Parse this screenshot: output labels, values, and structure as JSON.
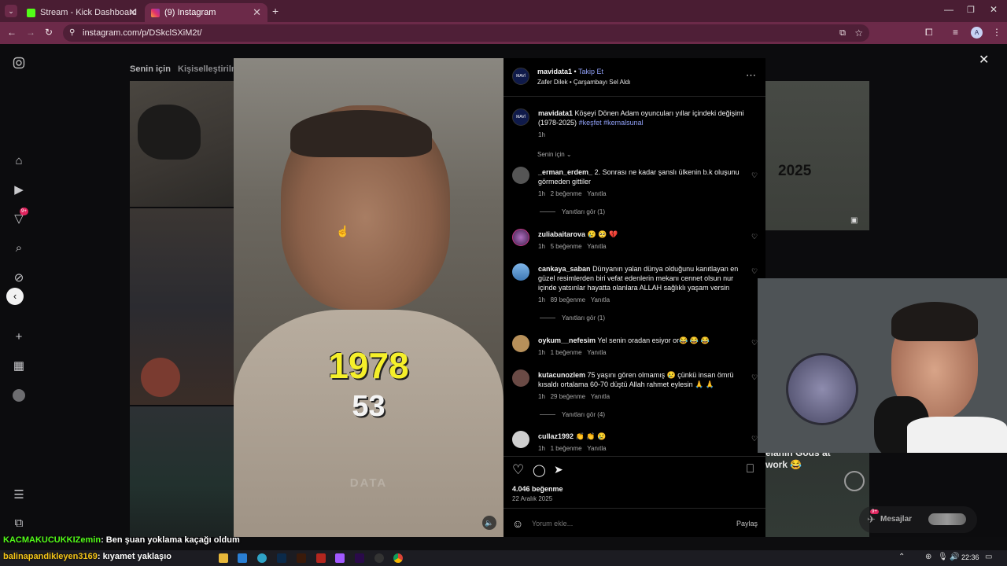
{
  "browser": {
    "tabs": [
      {
        "title": "Stream - Kick Dashboard"
      },
      {
        "title": "(9) Instagram"
      }
    ],
    "url": "instagram.com/p/DSkclSXiM2t/",
    "profile_initial": "A"
  },
  "feed": {
    "tabs": [
      "Senin için",
      "Kişiselleştirilme"
    ],
    "thumb_caption": "elanin Gods at work 😂",
    "thumb_year": "2025"
  },
  "sidebar": {
    "notification_badge": "9+"
  },
  "post": {
    "author": "mavidata1",
    "follow_label": "Takip Et",
    "audio": "Zafer Dilek • Çarşambayı Sel Aldı",
    "avatar_text": "MAVİ",
    "caption_text": "Köşeyi Dönen Adam oyuncuları yıllar içindeki değişimi (1978-2025)",
    "hashtags": [
      "#keşfet",
      "#kemalsunal"
    ],
    "caption_time": "1h",
    "sort_label": "Senin için",
    "likes": "4.046 beğenme",
    "date": "22 Aralık 2025",
    "comment_placeholder": "Yorum ekle...",
    "share_label": "Paylaş",
    "video_year": "1978",
    "video_age": "53",
    "video_watermark": "DATA"
  },
  "comments": [
    {
      "user": "_erman_erdem_",
      "text": "2. Sonrası ne kadar şanslı ülkenin b.k oluşunu görmeden gittiler",
      "time": "1h",
      "likes": "2 beğenme",
      "reply": "Yanıtla",
      "see_replies": "Yanıtları gör (1)"
    },
    {
      "user": "zuliabaitarova",
      "text": "😢 🥺 💔",
      "time": "1h",
      "likes": "5 beğenme",
      "reply": "Yanıtla"
    },
    {
      "user": "cankaya_saban",
      "text": "Dünyanın yalan dünya olduğunu kanıtlayan en güzel resimlerden biri vefat edenlerin mekanı cennet olsun nur içinde yatsınlar hayatta olanlara ALLAH sağlıklı yaşam versin",
      "time": "1h",
      "likes": "89 beğenme",
      "reply": "Yanıtla",
      "see_replies": "Yanıtları gör (1)"
    },
    {
      "user": "oykum__nefesim",
      "text": "Yel senin oradan esiyor or😂 😂 😂",
      "time": "1h",
      "likes": "1 beğenme",
      "reply": "Yanıtla"
    },
    {
      "user": "kutacunozlem",
      "text": "75 yaşını gören olmamış 😢 çünkü insan ömrü kısaldı ortalama 60-70 düştü Allah rahmet eylesin 🙏 🙏",
      "time": "1h",
      "likes": "29 beğenme",
      "reply": "Yanıtla",
      "see_replies": "Yanıtları gör (4)"
    },
    {
      "user": "cullaz1992",
      "text": "👏 👏 😢",
      "time": "1h",
      "likes": "1 beğenme",
      "reply": "Yanıtla"
    }
  ],
  "messages": {
    "label": "Mesajlar",
    "badge": "9+"
  },
  "chat": [
    {
      "user": "KACMAKUCUKKIZemin",
      "text": ": Ben şuan yoklama kaçağı oldum"
    },
    {
      "user": "balinapandikleyen3169",
      "text": ": kıyamet yaklaşıo"
    }
  ],
  "taskbar": {
    "time": "22:36"
  },
  "colors": {
    "tab_bar": "#4a1d33",
    "toolbar": "#6c2a49",
    "link_blue": "#8f9ff6",
    "year_yellow": "#f5ef2a"
  }
}
